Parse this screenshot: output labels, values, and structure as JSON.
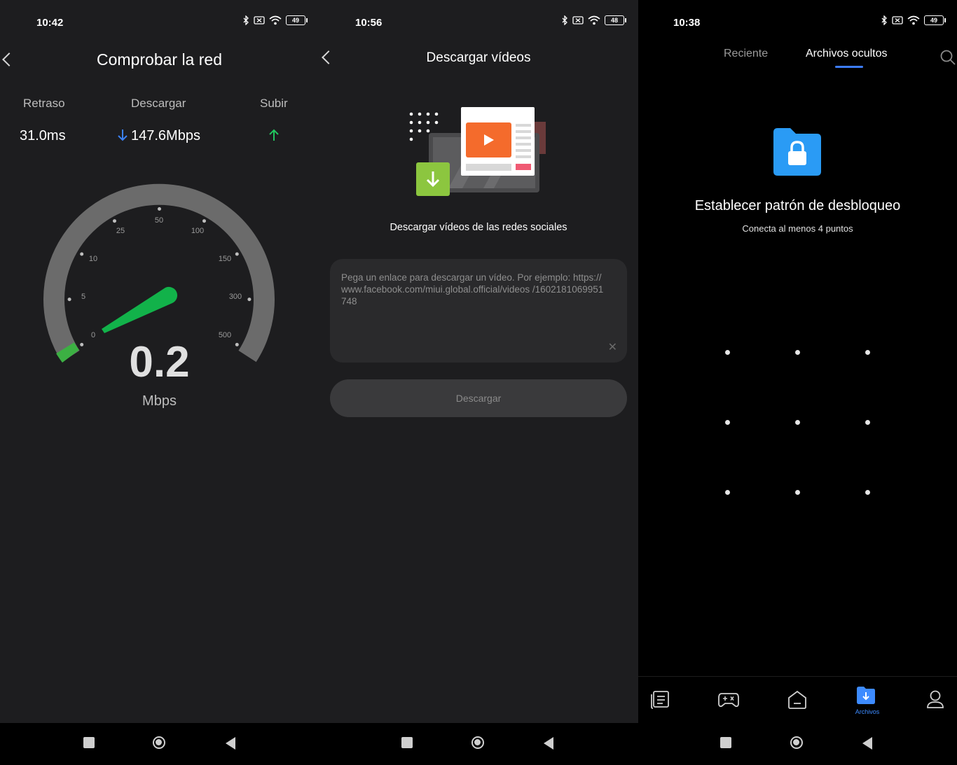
{
  "panel1": {
    "status": {
      "time": "10:42",
      "battery": "49"
    },
    "title": "Comprobar la red",
    "stats": [
      {
        "label": "Retraso",
        "value": "31.0ms"
      },
      {
        "label": "Descargar",
        "value": "147.6Mbps"
      },
      {
        "label": "Subir",
        "value": ""
      }
    ],
    "gauge": {
      "ticks": [
        "0",
        "5",
        "10",
        "25",
        "50",
        "100",
        "150",
        "300",
        "500"
      ],
      "speed": "0.2",
      "unit": "Mbps"
    },
    "colors": {
      "needle": "#22c55e",
      "track": "#6b6b6b",
      "download_arrow": "#3b82f6",
      "upload_arrow": "#22c55e"
    }
  },
  "panel2": {
    "status": {
      "time": "10:56",
      "battery": "48"
    },
    "title": "Descargar vídeos",
    "subtitle": "Descargar vídeos de las redes sociales",
    "input": {
      "placeholder": "Pega un enlace para descargar un vídeo. Por ejemplo: https://www.facebook.com/miui.global.official/videos /1602181069951748"
    },
    "download_button": "Descargar"
  },
  "panel3": {
    "status": {
      "time": "10:38",
      "battery": "49"
    },
    "tabs": [
      {
        "label": "Reciente",
        "active": false
      },
      {
        "label": "Archivos ocultos",
        "active": true
      }
    ],
    "lock_title": "Establecer patrón de desbloqueo",
    "lock_subtitle": "Conecta al menos 4 puntos",
    "bottom_nav": [
      {
        "icon": "document-list-icon",
        "label": ""
      },
      {
        "icon": "gamepad-icon",
        "label": ""
      },
      {
        "icon": "home-icon",
        "label": ""
      },
      {
        "icon": "files-download-icon",
        "label": "Archivos",
        "active": true
      },
      {
        "icon": "user-icon",
        "label": ""
      }
    ],
    "colors": {
      "accent": "#3d8bff",
      "folder": "#2a9bf5"
    }
  }
}
